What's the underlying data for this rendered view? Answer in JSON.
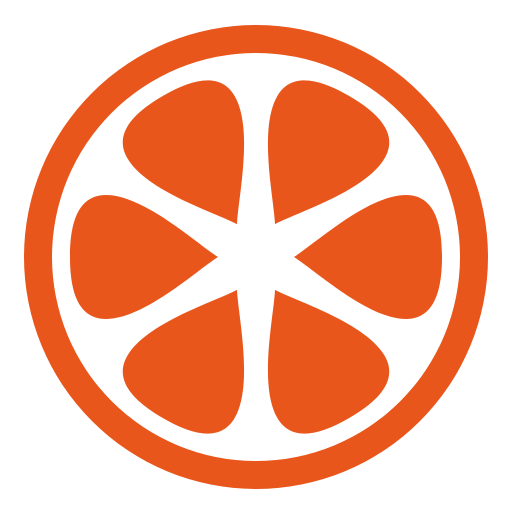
{
  "icon": {
    "name": "orange-slice-icon",
    "segments": 6
  },
  "colors": {
    "background": "#ffffff",
    "rind": "#e8561c",
    "pith": "#ffffff",
    "segment": "#e8561c"
  }
}
